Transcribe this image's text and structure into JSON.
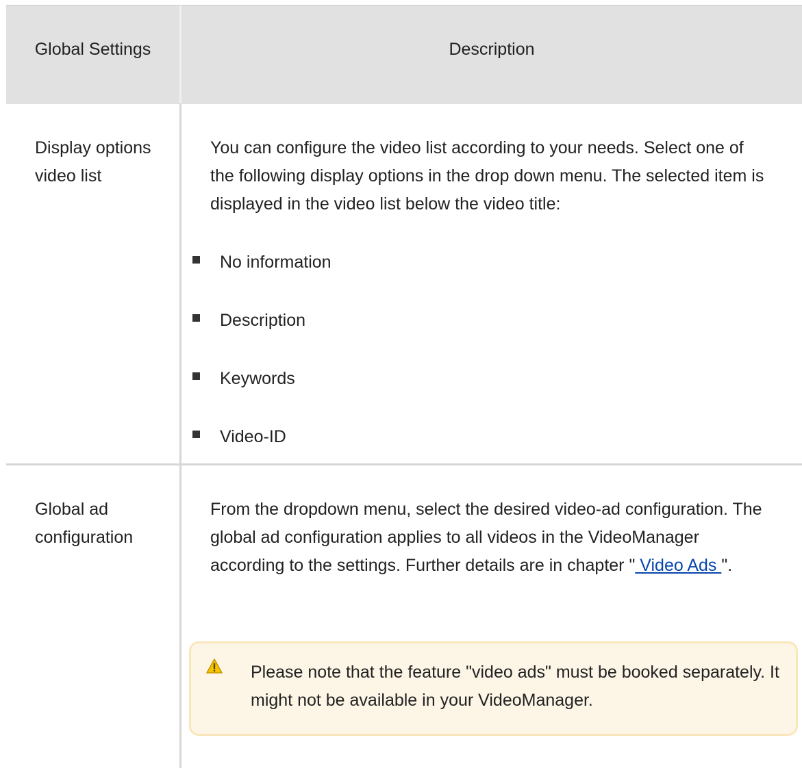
{
  "table": {
    "headers": {
      "col1": "Global Settings",
      "col2": "Description"
    },
    "rows": [
      {
        "setting": "Display options video list",
        "description": "You can configure the video list according to your needs. Select one of the following display options in the drop down menu. The selected item is displayed in the video list below the video title:",
        "options": [
          "No information",
          "Description",
          "Keywords",
          "Video-ID"
        ]
      },
      {
        "setting": "Global ad configuration",
        "description_before": "From the dropdown menu, select the desired video-ad configuration. The global ad configuration applies to all videos in the VideoManager according to the settings. Further details are in chapter \"",
        "link": " Video Ads ",
        "description_after": "\".",
        "note": {
          "icon": "warning-icon",
          "text": "Please note that the feature \"video ads\" must be booked separately. It might not be available in your VideoManager."
        }
      }
    ]
  },
  "colors": {
    "header_bg": "#e1e1e1",
    "separator": "#d6d6d6",
    "note_bg": "#fdf6e7",
    "note_border": "#fae6bd",
    "link": "#0645ad"
  }
}
